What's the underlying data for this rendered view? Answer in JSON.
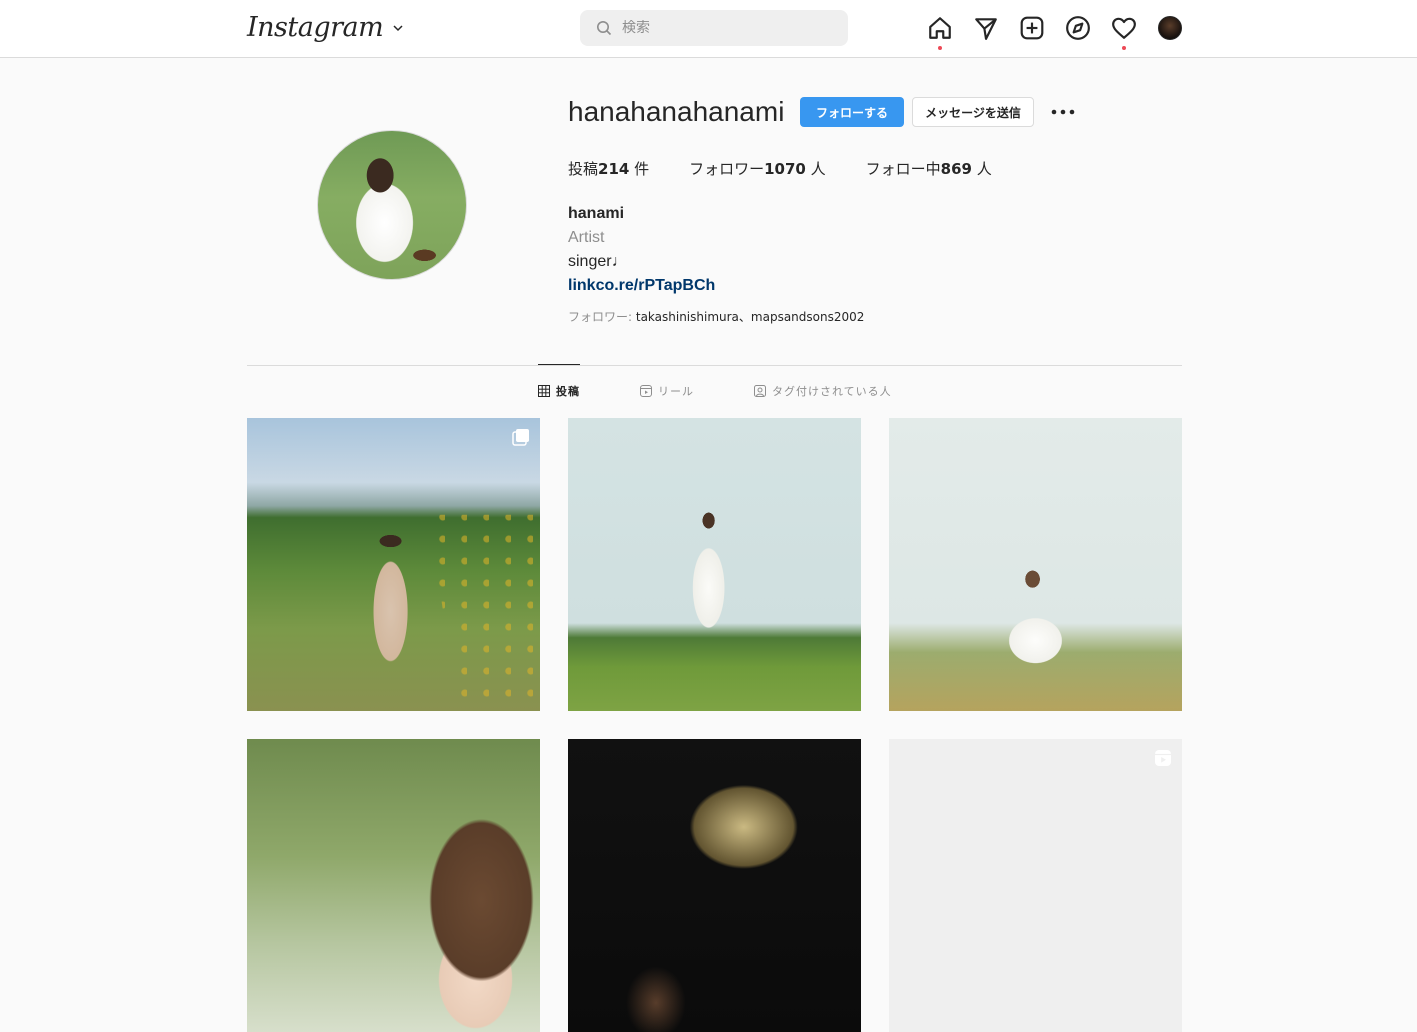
{
  "nav": {
    "logo": "Instagram",
    "search_placeholder": "検索",
    "icons": [
      "home-icon",
      "direct-icon",
      "new-post-icon",
      "explore-icon",
      "activity-heart-icon",
      "profile-avatar"
    ],
    "notification_dot_color": "#ed4956"
  },
  "profile": {
    "username": "hanahanahanami",
    "follow_label": "フォローする",
    "message_label": "メッセージを送信",
    "stats": {
      "posts_prefix": "投稿",
      "posts_count": "214",
      "posts_suffix": " 件",
      "followers_prefix": "フォロワー",
      "followers_count": "1070",
      "followers_suffix": " 人",
      "following_prefix": "フォロー中",
      "following_count": "869",
      "following_suffix": " 人"
    },
    "display_name": "hanami",
    "category": "Artist",
    "bio": "singer♩",
    "link": "linkco.re/rPTapBCh",
    "followed_by_label": "フォロワー: ",
    "followed_by_names": "takashinishimura、mapsandsons2002"
  },
  "tabs": [
    {
      "label": "投稿",
      "active": true
    },
    {
      "label": "リール",
      "active": false
    },
    {
      "label": "タグ付けされている人",
      "active": false
    }
  ],
  "colors": {
    "accent_blue": "#3897f0",
    "link_blue": "#00376b",
    "border": "#dbdbdb",
    "muted_text": "#8e8e8e"
  }
}
